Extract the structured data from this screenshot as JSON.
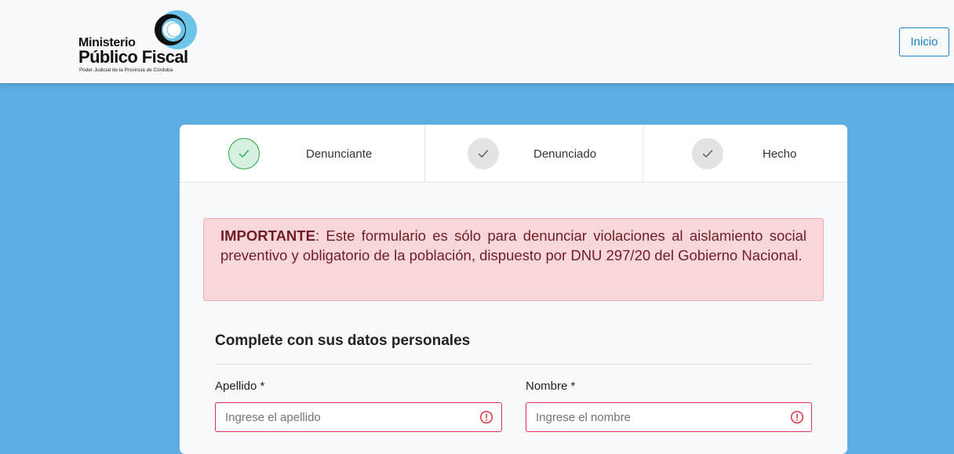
{
  "header": {
    "logo": {
      "line1": "Ministerio",
      "line2": "Público Fiscal",
      "line3": "Poder Judicial de la Provincia de Córdoba",
      "icon": "mpf-emblem-icon"
    },
    "home_button": "Inicio"
  },
  "steps": [
    {
      "label": "Denunciante",
      "state": "complete",
      "icon": "check-icon"
    },
    {
      "label": "Denunciado",
      "state": "pending",
      "icon": "check-icon"
    },
    {
      "label": "Hecho",
      "state": "pending",
      "icon": "check-icon"
    }
  ],
  "alert": {
    "title": "IMPORTANTE",
    "text": ": Este formulario es sólo para denunciar violaciones al aislamiento social preventivo y obligatorio de la población, dispuesto por DNU 297/20 del Gobierno Nacional."
  },
  "form": {
    "section_title": "Complete con sus datos personales",
    "fields": [
      {
        "label": "Apellido *",
        "placeholder": "Ingrese el apellido",
        "value": "",
        "status": "invalid",
        "icon": "error-icon"
      },
      {
        "label": "Nombre *",
        "placeholder": "Ingrese el nombre",
        "value": "",
        "status": "invalid",
        "icon": "error-icon"
      }
    ]
  },
  "colors": {
    "page_background": "#5dade2",
    "header_background": "#f8f9fa",
    "accent": "#1a82c9",
    "step_complete": "#28a745",
    "alert_background": "#f8d7da",
    "alert_text": "#721c24",
    "error": "#dc3545"
  }
}
